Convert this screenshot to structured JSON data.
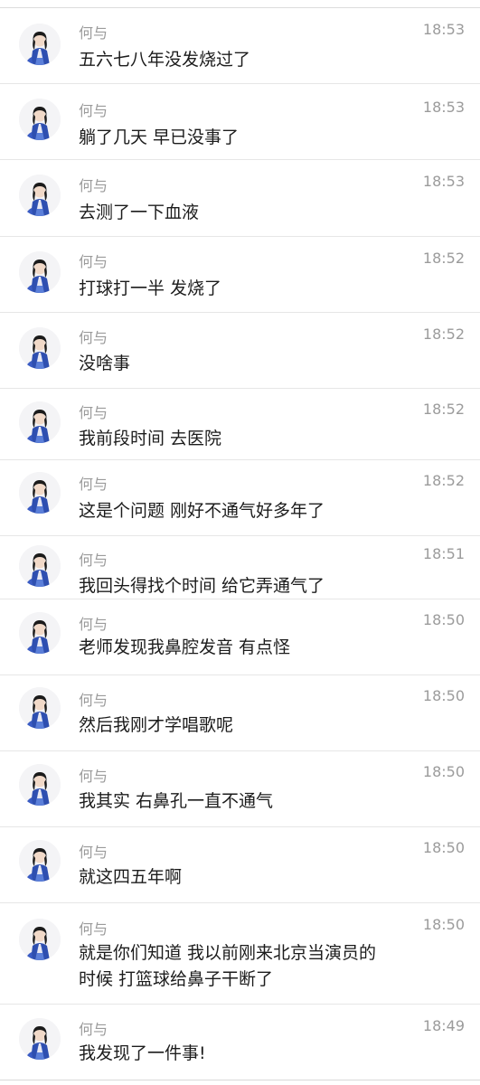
{
  "messages": [
    {
      "sender": "何与",
      "time": "18:53",
      "lines": [
        "五六七八年没发烧过了"
      ]
    },
    {
      "sender": "何与",
      "time": "18:53",
      "lines": [
        "躺了几天 早已没事了"
      ]
    },
    {
      "sender": "何与",
      "time": "18:53",
      "lines": [
        "去测了一下血液"
      ]
    },
    {
      "sender": "何与",
      "time": "18:52",
      "lines": [
        "打球打一半 发烧了"
      ]
    },
    {
      "sender": "何与",
      "time": "18:52",
      "lines": [
        "没啥事"
      ]
    },
    {
      "sender": "何与",
      "time": "18:52",
      "lines": [
        "我前段时间 去医院"
      ]
    },
    {
      "sender": "何与",
      "time": "18:52",
      "lines": [
        "这是个问题 刚好不通气好多年了"
      ]
    },
    {
      "sender": "何与",
      "time": "18:51",
      "lines": [
        "我回头得找个时间 给它弄通气了"
      ]
    },
    {
      "sender": "何与",
      "time": "18:50",
      "lines": [
        "老师发现我鼻腔发音 有点怪"
      ]
    },
    {
      "sender": "何与",
      "time": "18:50",
      "lines": [
        "然后我刚才学唱歌呢"
      ]
    },
    {
      "sender": "何与",
      "time": "18:50",
      "lines": [
        "我其实 右鼻孔一直不通气"
      ]
    },
    {
      "sender": "何与",
      "time": "18:50",
      "lines": [
        "就这四五年啊"
      ]
    },
    {
      "sender": "何与",
      "time": "18:50",
      "lines": [
        "就是你们知道 我以前刚来北京当演员的",
        "时候 打篮球给鼻子干断了"
      ]
    },
    {
      "sender": "何与",
      "time": "18:49",
      "lines": [
        "我发现了一件事!"
      ]
    }
  ]
}
